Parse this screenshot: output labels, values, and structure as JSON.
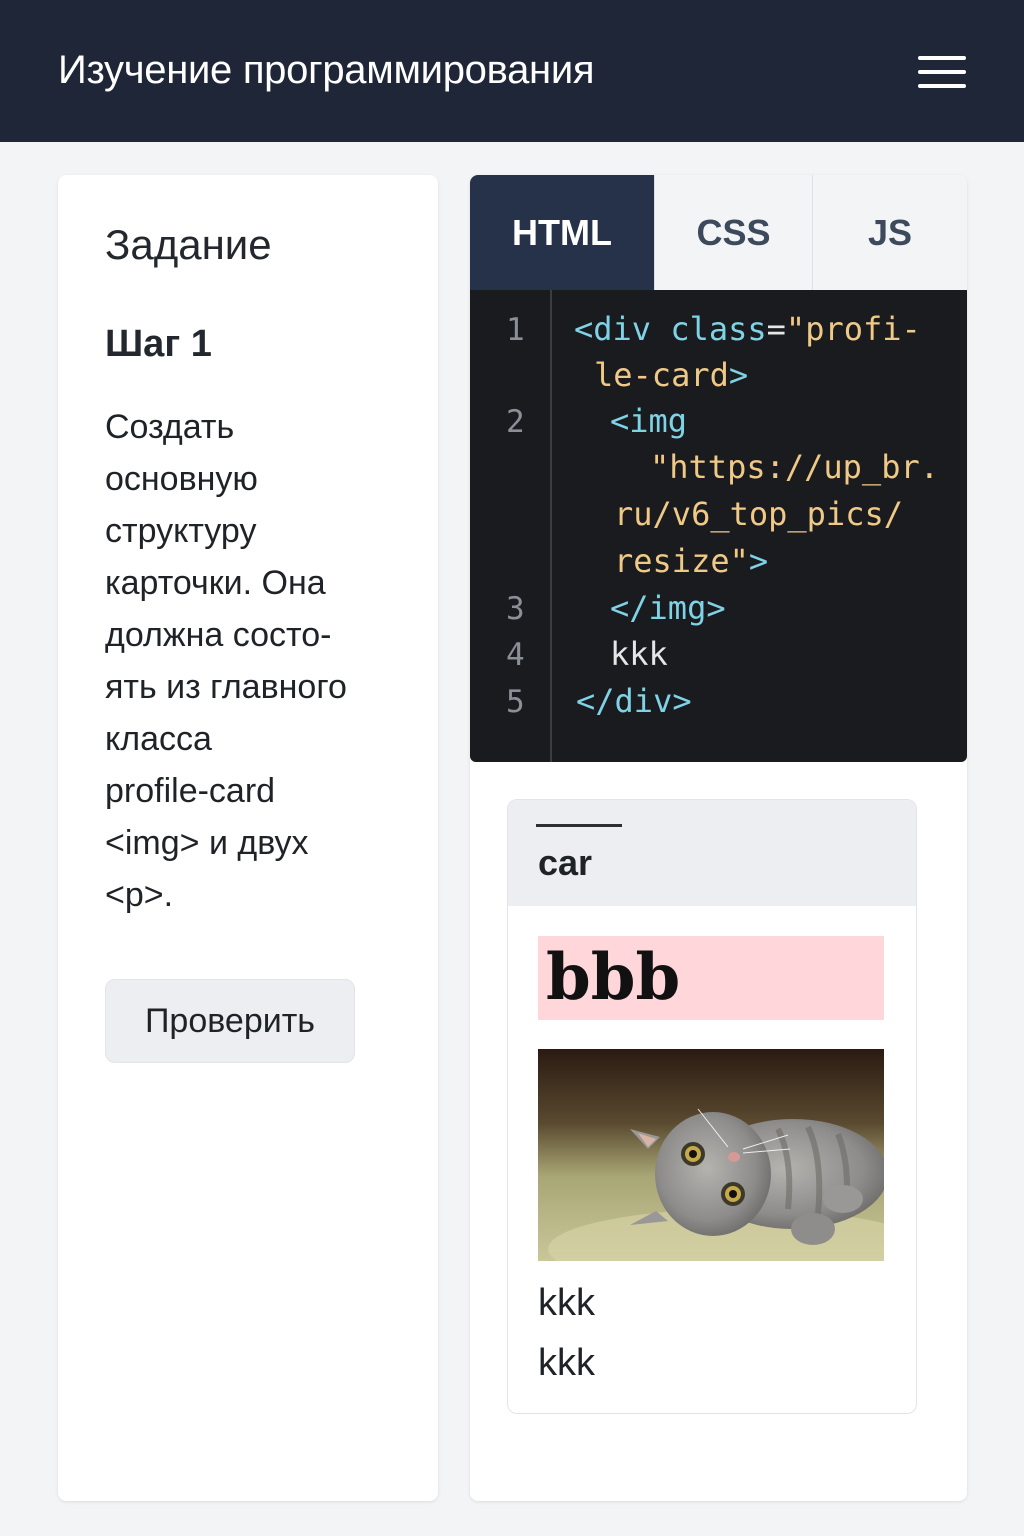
{
  "header": {
    "title": "Изучение программирования",
    "menu_icon": "hamburger-menu-icon"
  },
  "task": {
    "title": "Задание",
    "step": "Шаг 1",
    "description_lines": [
      "Создать",
      "основную",
      "структуру",
      "карточки. Она",
      "должна состо-",
      "ять из главного",
      "класса",
      "profile-card",
      "<img> и двух",
      "<p>."
    ],
    "check_button": "Проверить"
  },
  "editor": {
    "tabs": [
      "HTML",
      "CSS",
      "JS"
    ],
    "active_tab": "HTML",
    "line_numbers": [
      "1",
      "2",
      "3",
      "4",
      "5"
    ],
    "code": {
      "l1_open": "<div",
      "l1_attr": "class",
      "l1_eq": "=",
      "l1_val": "\"profi-",
      "l1_val_cont": "le-card",
      "l1_close": ">",
      "l2_open": "<img",
      "l2_val": "\"https://up_br.",
      "l2_val_cont1": "ru/v6_top_pics/",
      "l2_val_cont2": "resize\"",
      "l2_close": ">",
      "l3": "</img>",
      "l4": "kkk",
      "l5": "</div>"
    }
  },
  "preview": {
    "header_text": "car",
    "heading": "bbb",
    "image_icon": "cat-photo",
    "paragraphs": [
      "kkk",
      "kkk"
    ]
  },
  "colors": {
    "topbar": "#1e2637",
    "tab_active": "#26324a",
    "code_bg": "#1a1b1e",
    "code_tag": "#7fd3e6",
    "code_string": "#f0c987",
    "heading_bg": "#ffd6d9"
  }
}
